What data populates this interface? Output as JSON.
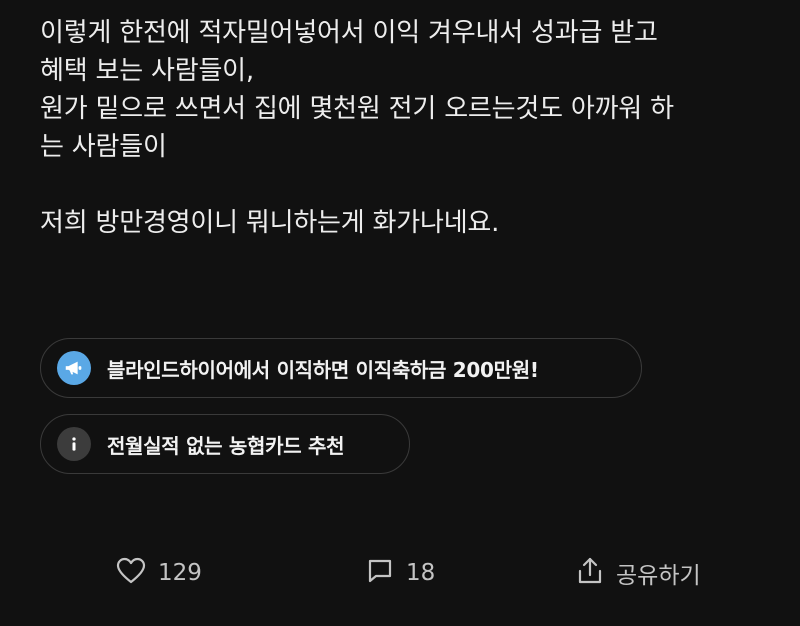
{
  "post": {
    "paragraph1": [
      "이렇게 한전에 적자밀어넣어서 이익 겨우내서 성과급 받고",
      "혜택 보는 사람들이,",
      "원가 밑으로 쓰면서 집에 몇천원 전기 오르는것도 아까워 하",
      "는 사람들이"
    ],
    "paragraph2": "저희 방만경영이니 뭐니하는게 화가나네요."
  },
  "chips": {
    "ad": {
      "label": "블라인드하이어에서 이직하면 이직축하금 200만원!",
      "icon": "megaphone-icon"
    },
    "info": {
      "label": "전월실적 없는 농협카드 추천",
      "icon": "info-icon"
    }
  },
  "actions": {
    "like": {
      "count": "129",
      "icon": "heart-icon"
    },
    "comment": {
      "count": "18",
      "icon": "comment-icon"
    },
    "share": {
      "label": "공유하기",
      "icon": "share-icon"
    }
  },
  "colors": {
    "background": "#111111",
    "text": "#ededed",
    "chip_border": "#3a3a3a",
    "megaphone_bg": "#5aa8e6",
    "info_bg": "#3c3c3c",
    "action_text": "#c4c4c4"
  }
}
